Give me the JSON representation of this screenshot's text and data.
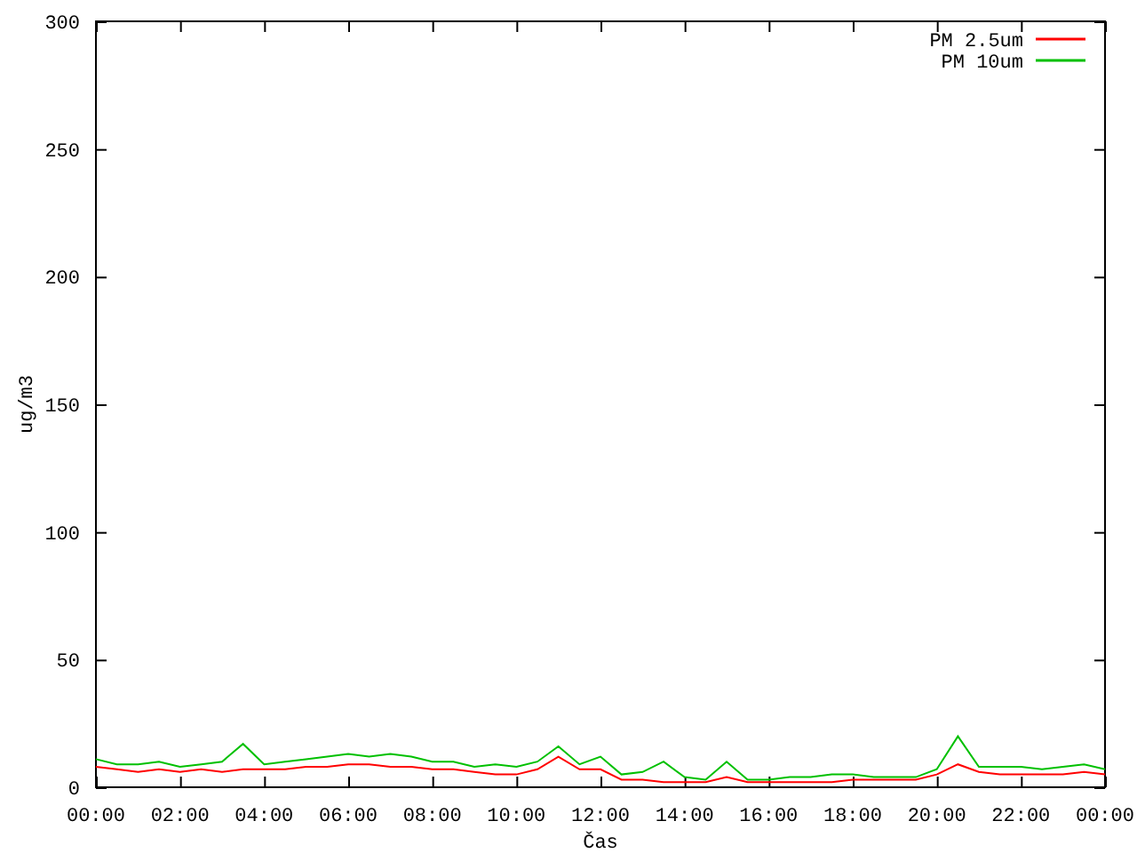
{
  "chart_data": {
    "type": "line",
    "legend": "upper right",
    "xlabel": "Čas",
    "ylabel": "ug/m3",
    "xlim": [
      0,
      24
    ],
    "ylim": [
      0,
      300
    ],
    "x": [
      0,
      0.5,
      1,
      1.5,
      2,
      2.5,
      3,
      3.5,
      4,
      4.5,
      5,
      5.5,
      6,
      6.5,
      7,
      7.5,
      8,
      8.5,
      9,
      9.5,
      10,
      10.5,
      11,
      11.5,
      12,
      12.5,
      13,
      13.5,
      14,
      14.5,
      15,
      15.5,
      16,
      16.5,
      17,
      17.5,
      18,
      18.5,
      19,
      19.5,
      20,
      20.5,
      21,
      21.5,
      22,
      22.5,
      23,
      23.5,
      24
    ],
    "xticks": [
      {
        "value": 0,
        "label": "00:00"
      },
      {
        "value": 2,
        "label": "02:00"
      },
      {
        "value": 4,
        "label": "04:00"
      },
      {
        "value": 6,
        "label": "06:00"
      },
      {
        "value": 8,
        "label": "08:00"
      },
      {
        "value": 10,
        "label": "10:00"
      },
      {
        "value": 12,
        "label": "12:00"
      },
      {
        "value": 14,
        "label": "14:00"
      },
      {
        "value": 16,
        "label": "16:00"
      },
      {
        "value": 18,
        "label": "18:00"
      },
      {
        "value": 20,
        "label": "20:00"
      },
      {
        "value": 22,
        "label": "22:00"
      },
      {
        "value": 24,
        "label": "00:00"
      }
    ],
    "yticks": [
      0,
      50,
      100,
      150,
      200,
      250,
      300
    ],
    "series": [
      {
        "name": "PM 2.5um",
        "color": "#ff0000",
        "values": [
          8,
          7,
          6,
          7,
          6,
          7,
          6,
          7,
          7,
          7,
          8,
          8,
          9,
          9,
          8,
          8,
          7,
          7,
          6,
          5,
          5,
          7,
          12,
          7,
          7,
          3,
          3,
          2,
          2,
          2,
          4,
          2,
          2,
          2,
          2,
          2,
          3,
          3,
          3,
          3,
          5,
          9,
          6,
          5,
          5,
          5,
          5,
          6,
          5
        ]
      },
      {
        "name": "PM 10um",
        "color": "#00c000",
        "values": [
          11,
          9,
          9,
          10,
          8,
          9,
          10,
          17,
          9,
          10,
          11,
          12,
          13,
          12,
          13,
          12,
          10,
          10,
          8,
          9,
          8,
          10,
          16,
          9,
          12,
          5,
          6,
          10,
          4,
          3,
          10,
          3,
          3,
          4,
          4,
          5,
          5,
          4,
          4,
          4,
          7,
          20,
          8,
          8,
          8,
          7,
          8,
          9,
          7
        ]
      }
    ]
  }
}
